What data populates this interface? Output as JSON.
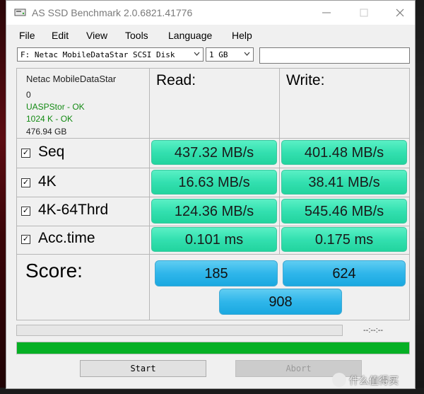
{
  "window": {
    "title": "AS SSD Benchmark 2.0.6821.41776"
  },
  "menu": [
    "File",
    "Edit",
    "View",
    "Tools",
    "Language",
    "Help"
  ],
  "drive_select": {
    "value": "F: Netac MobileDataStar SCSI Disk"
  },
  "size_select": {
    "value": "1 GB"
  },
  "device": {
    "name": "Netac MobileDataStar",
    "id": "0",
    "driver_status": "UASPStor - OK",
    "alignment_status": "1024 K - OK",
    "capacity": "476.94 GB"
  },
  "columns": {
    "read": "Read:",
    "write": "Write:"
  },
  "rows": [
    {
      "label": "Seq",
      "checked": true,
      "read": "437.32 MB/s",
      "write": "401.48 MB/s"
    },
    {
      "label": "4K",
      "checked": true,
      "read": "16.63 MB/s",
      "write": "38.41 MB/s"
    },
    {
      "label": "4K-64Thrd",
      "checked": true,
      "read": "124.36 MB/s",
      "write": "545.46 MB/s"
    },
    {
      "label": "Acc.time",
      "checked": true,
      "read": "0.101 ms",
      "write": "0.175 ms"
    }
  ],
  "score": {
    "label": "Score:",
    "read": "185",
    "write": "624",
    "total": "908"
  },
  "progress": {
    "elapsed": "--:--:--",
    "overall_fraction": 1.0
  },
  "buttons": {
    "start": "Start",
    "abort": "Abort"
  },
  "watermark": {
    "text": "什么值得买"
  },
  "colors": {
    "result_green": "#33e0b0",
    "score_blue": "#2fb6ea",
    "progress_green": "#06b025",
    "ok_text": "#138a13"
  }
}
